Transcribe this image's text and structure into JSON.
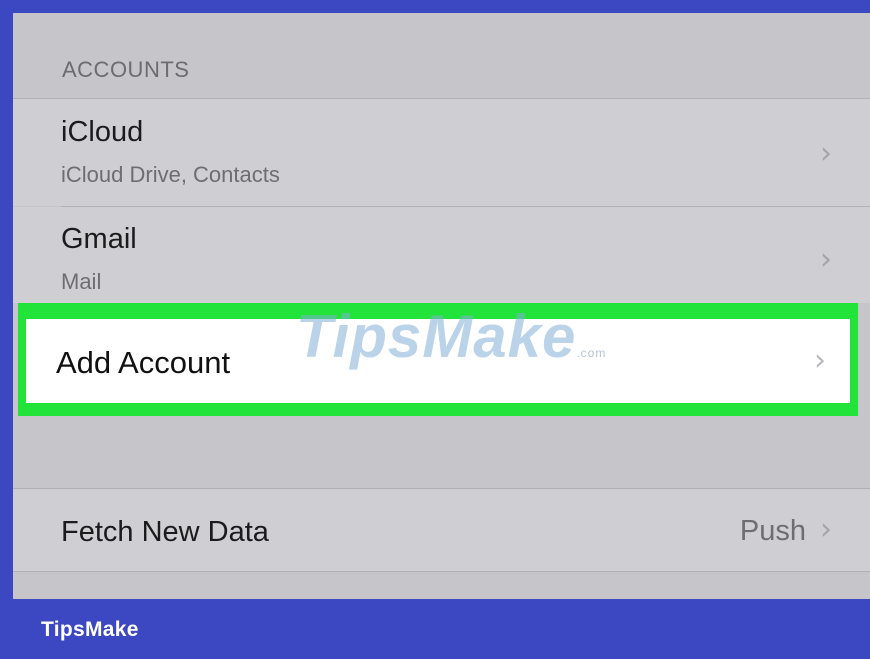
{
  "section": {
    "header": "ACCOUNTS"
  },
  "accounts": [
    {
      "title": "iCloud",
      "subtitle": "iCloud Drive, Contacts"
    },
    {
      "title": "Gmail",
      "subtitle": "Mail"
    }
  ],
  "add_account": {
    "label": "Add Account"
  },
  "fetch": {
    "label": "Fetch New Data",
    "value": "Push"
  },
  "watermark": {
    "text": "TipsMake",
    "suffix": ".com"
  },
  "brand": {
    "label": "TipsMake"
  },
  "icons": {
    "chevron": "chevron-right-icon"
  },
  "colors": {
    "highlight": "#22e33a",
    "frame": "#3c47c2"
  }
}
